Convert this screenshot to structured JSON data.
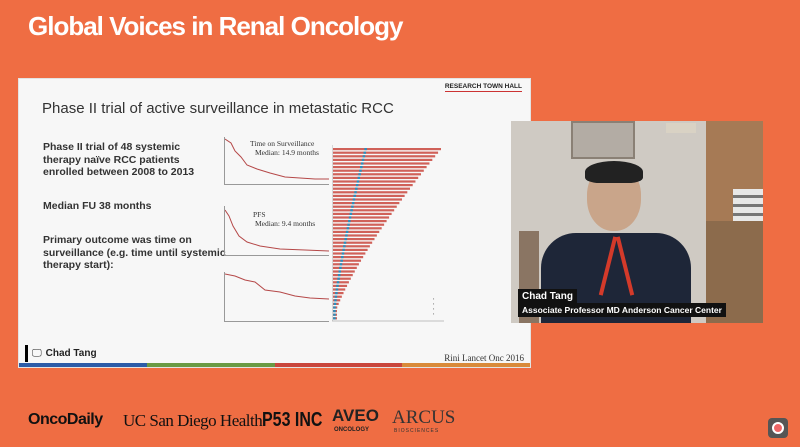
{
  "header": {
    "title": "Global Voices in Renal Oncology"
  },
  "slide": {
    "badge": "RESEARCH TOWN HALL",
    "title": "Phase II trial of active surveillance in metastatic RCC",
    "bullets": [
      "Phase II trial of 48 systemic therapy naïve RCC patients enrolled between 2008 to 2013",
      "Median FU 38 months",
      "Primary outcome was time on surveillance (e.g. time until systemic therapy start):"
    ],
    "km_plots": [
      {
        "label_1": "Time on Surveillance",
        "label_2": "Median: 14.9 months"
      },
      {
        "label_1": "PFS",
        "label_2": "Median: 9.4 months"
      }
    ],
    "citation": "Rini Lancet Onc 2016",
    "presenter": {
      "name": "Chad Tang",
      "icon": "monitor-icon"
    },
    "color_bar": [
      "#2c5ca8",
      "#6a9a44",
      "#c9463d",
      "#d98a3a"
    ]
  },
  "video": {
    "name": "Chad Tang",
    "role": "Associate Professor MD Anderson Cancer Center"
  },
  "sponsors": {
    "oncodaily": "OncoDaily",
    "ucsd": "UC San Diego Health",
    "p53": "P53 INC",
    "aveo": "AVEO",
    "aveo_sub": "ONCOLOGY",
    "arcus": "ARCUS",
    "arcus_sub": "BIOSCIENCES"
  }
}
